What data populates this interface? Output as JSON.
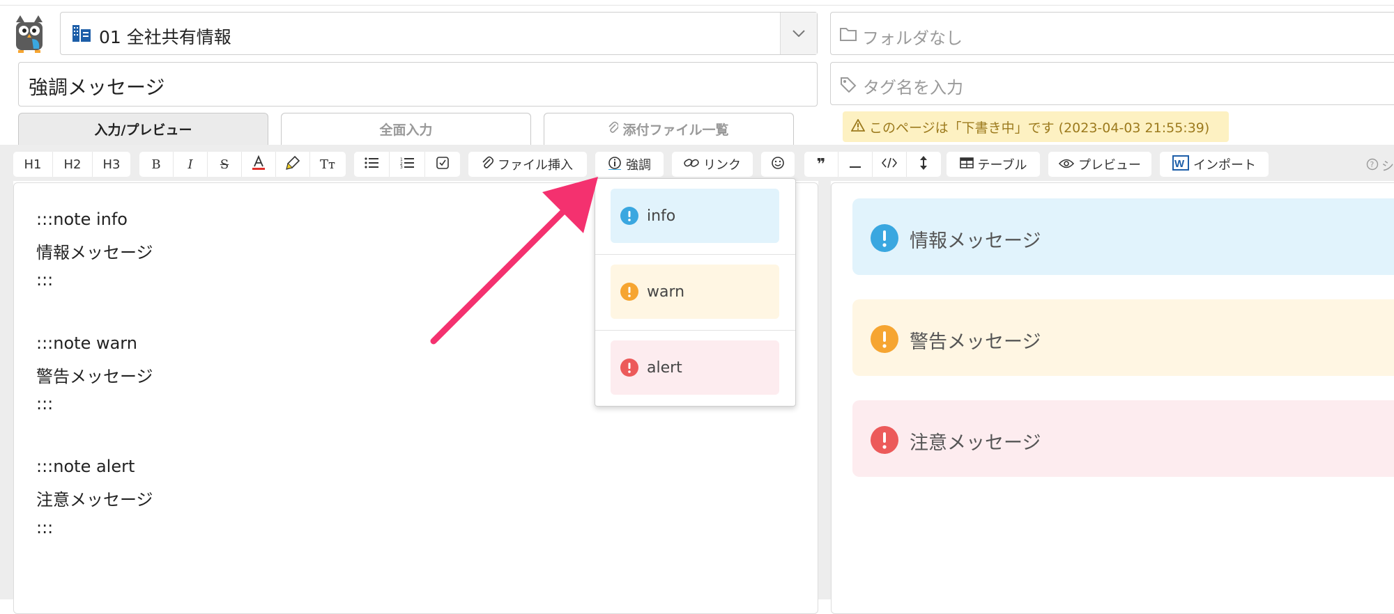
{
  "header": {
    "group_select_value": "01 全社共有情報",
    "folder_placeholder": "フォルダなし",
    "title_value": "強調メッセージ",
    "tag_placeholder": "タグ名を入力"
  },
  "tabs": [
    {
      "label": "入力/プレビュー",
      "active": true
    },
    {
      "label": "全面入力",
      "active": false
    },
    {
      "label": "添付ファイル一覧",
      "active": false
    }
  ],
  "draft_badge": "このページは「下書き中」です (2023-04-03 21:55:39)",
  "toolbar": {
    "h1": "H1",
    "h2": "H2",
    "h3": "H3",
    "file_insert": "ファイル挿入",
    "emphasis": "強調",
    "link": "リンク",
    "table": "テーブル",
    "preview": "プレビュー",
    "import": "インポート",
    "help_partial": "シ"
  },
  "editor_lines": [
    ":::note info",
    "情報メッセージ",
    ":::",
    ":::note warn",
    "警告メッセージ",
    ":::",
    ":::note alert",
    "注意メッセージ",
    ":::"
  ],
  "dropdown": [
    {
      "label": "info",
      "color": "#3aa7e0",
      "bg": "#e1f3fc"
    },
    {
      "label": "warn",
      "color": "#f6a531",
      "bg": "#fff6e3"
    },
    {
      "label": "alert",
      "color": "#ec5a5a",
      "bg": "#fdecef"
    }
  ],
  "preview_notes": [
    {
      "text": "情報メッセージ",
      "color": "#3aa7e0",
      "bg": "#e1f3fc"
    },
    {
      "text": "警告メッセージ",
      "color": "#f6a531",
      "bg": "#fff6e3"
    },
    {
      "text": "注意メッセージ",
      "color": "#ec5a5a",
      "bg": "#fdecef"
    }
  ],
  "colors": {
    "accent_arrow": "#f4316f",
    "draft_bg": "#fdf1c2",
    "draft_text": "#9c7a1d"
  }
}
